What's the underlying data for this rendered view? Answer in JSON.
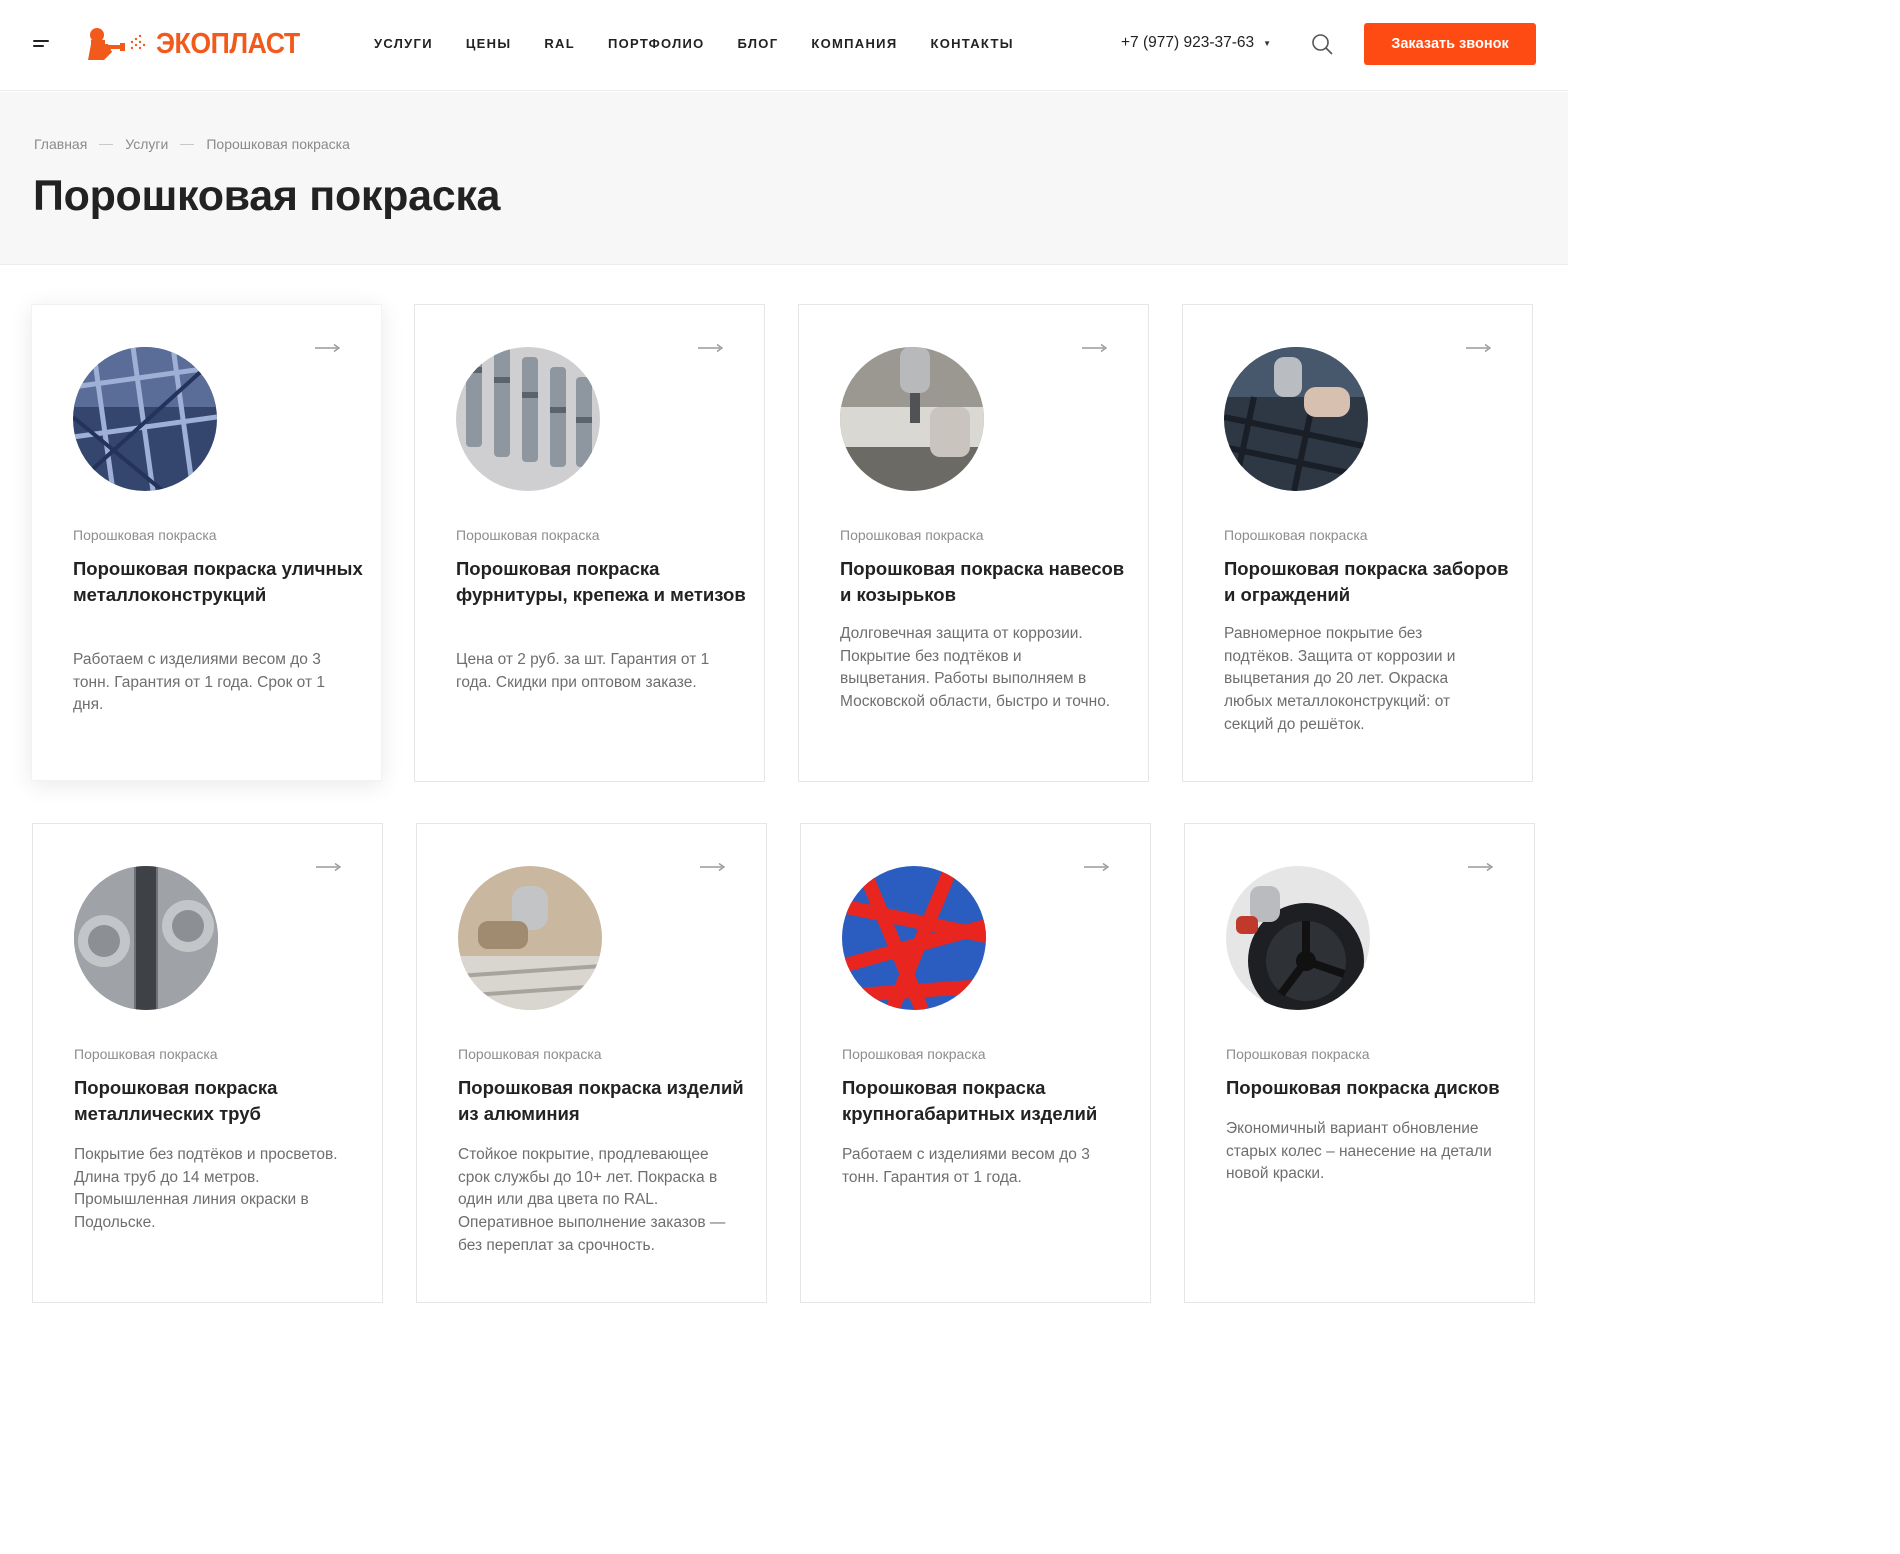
{
  "header": {
    "logo_text": "ЭКОПЛАСТ",
    "nav": [
      "УСЛУГИ",
      "ЦЕНЫ",
      "RAL",
      "ПОРТФОЛИО",
      "БЛОГ",
      "КОМПАНИЯ",
      "КОНТАКТЫ"
    ],
    "phone": "+7 (977) 923-37-63",
    "cta_label": "Заказать звонок"
  },
  "breadcrumb": [
    "Главная",
    "Услуги",
    "Порошковая покраска"
  ],
  "page_title": "Порошковая покраска",
  "colors": {
    "accent": "#fe4b13",
    "logo": "#f25a1c",
    "hero_bg": "#f7f7f7"
  },
  "cards": [
    {
      "category": "Порошковая покраска",
      "title": "Порошковая покраска уличных металлоконструкций",
      "desc": "Работаем с изделиями весом до 3 тонн. Гарантия от 1 года. Срок от 1 дня."
    },
    {
      "category": "Порошковая покраска",
      "title": "Порошковая покраска фурнитуры, крепежа и метизов",
      "desc": "Цена от 2 руб. за шт. Гарантия от 1 года. Скидки при оптовом заказе."
    },
    {
      "category": "Порошковая покраска",
      "title": "Порошковая покраска навесов и козырьков",
      "desc": "Долговечная защита от коррозии. Покрытие без подтёков и выцветания. Работы выполняем в Московской области, быстро и точно."
    },
    {
      "category": "Порошковая покраска",
      "title": "Порошковая покраска заборов и ограждений",
      "desc": "Равномерное покрытие без подтёков. Защита от коррозии и выцветания до 20 лет. Окраска любых металлоконструкций: от секций до решёток."
    },
    {
      "category": "Порошковая покраска",
      "title": "Порошковая покраска металлических труб",
      "desc": "Покрытие без подтёков и просветов. Длина труб до 14 метров. Промышленная линия окраски в Подольске."
    },
    {
      "category": "Порошковая покраска",
      "title": "Порошковая покраска изделий из алюминия",
      "desc": "Стойкое покрытие, продлевающее срок службы до 10+ лет. Покраска в один или два цвета по RAL. Оперативное выполнение заказов — без переплат за срочность."
    },
    {
      "category": "Порошковая покраска",
      "title": "Порошковая покраска крупногабаритных изделий",
      "desc": "Работаем с изделиями весом до 3 тонн. Гарантия от 1 года."
    },
    {
      "category": "Порошковая покраска",
      "title": "Порошковая покраска дисков",
      "desc": "Экономичный вариант обновление старых колес – нанесение на детали новой краски."
    }
  ]
}
